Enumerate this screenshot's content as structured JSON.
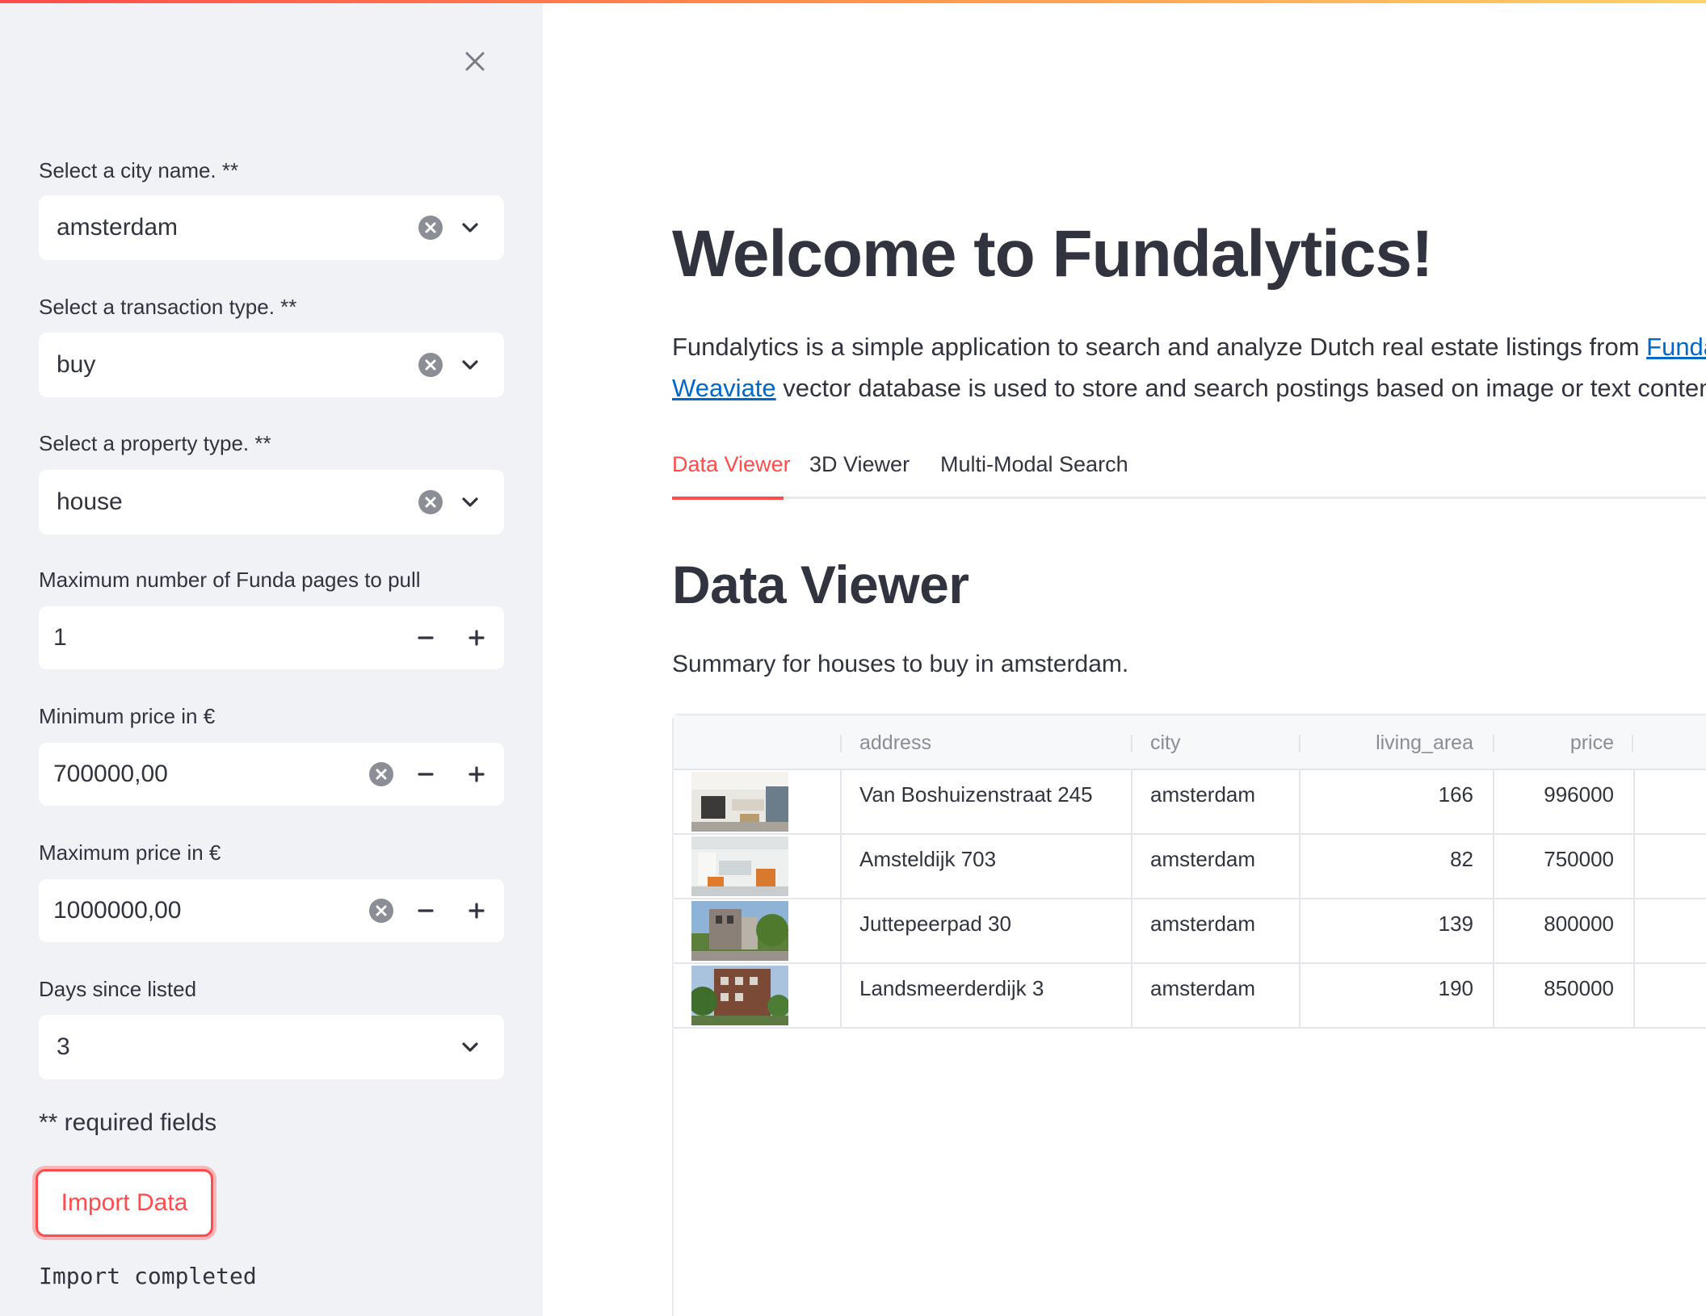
{
  "sidebar": {
    "city": {
      "label": "Select a city name. **",
      "value": "amsterdam"
    },
    "transaction": {
      "label": "Select a transaction type. **",
      "value": "buy"
    },
    "property": {
      "label": "Select a property type. **",
      "value": "house"
    },
    "pages": {
      "label": "Maximum number of Funda pages to pull",
      "value": "1"
    },
    "min_price": {
      "label": "Minimum price in €",
      "value": "700000,00"
    },
    "max_price": {
      "label": "Maximum price in €",
      "value": "1000000,00"
    },
    "days": {
      "label": "Days since listed",
      "value": "3"
    },
    "required_note": "** required fields",
    "import_button": "Import Data",
    "import_status": "Import completed"
  },
  "main": {
    "title": "Welcome to Fundalytics!",
    "intro": {
      "part1": "Fundalytics is a simple application to search and analyze Dutch real estate listings from ",
      "link1": "Funda",
      "part2": ".",
      "link2": "Weaviate",
      "part3": " vector database is used to store and search postings based on image or text content."
    },
    "tabs": [
      "Data Viewer",
      "3D Viewer",
      "Multi-Modal Search"
    ],
    "section_title": "Data Viewer",
    "summary": "Summary for houses to buy in amsterdam.",
    "table": {
      "columns": [
        "address",
        "city",
        "living_area",
        "price"
      ],
      "rows": [
        {
          "address": "Van Boshuizenstraat 245",
          "city": "amsterdam",
          "living_area": "166",
          "price": "996000"
        },
        {
          "address": "Amsteldijk 703",
          "city": "amsterdam",
          "living_area": "82",
          "price": "750000"
        },
        {
          "address": "Juttepeerpad 30",
          "city": "amsterdam",
          "living_area": "139",
          "price": "800000"
        },
        {
          "address": "Landsmeerderdijk 3",
          "city": "amsterdam",
          "living_area": "190",
          "price": "850000"
        }
      ]
    }
  },
  "colors": {
    "accent": "#ff4b4b",
    "link": "#0068c9",
    "sidebar_bg": "#f0f2f6",
    "text": "#31333f"
  },
  "icons": [
    "close-icon",
    "clear-icon",
    "chevron-down-icon",
    "minus-icon",
    "plus-icon"
  ]
}
